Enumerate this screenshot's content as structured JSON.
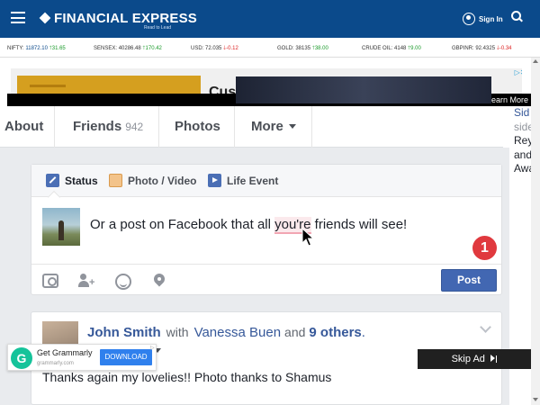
{
  "header": {
    "logo": "FINANCIAL EXPRESS",
    "tagline": "Read to Lead",
    "signin": "Sign In"
  },
  "ticker": [
    {
      "name": "NIFTY:",
      "value": "11872.10",
      "change": "31.65",
      "dir": "up"
    },
    {
      "name": "SENSEX:",
      "value": "40286.48",
      "change": "170.42",
      "dir": "up"
    },
    {
      "name": "USD:",
      "value": "72.035",
      "change": "-0.12",
      "dir": "down"
    },
    {
      "name": "GOLD:",
      "value": "38135",
      "change": "38.00",
      "dir": "up"
    },
    {
      "name": "CRUDE OIL:",
      "value": "4148",
      "change": "9.00",
      "dir": "up"
    },
    {
      "name": "GBPINR:",
      "value": "92.4325",
      "change": "-0.34",
      "dir": "down"
    }
  ],
  "ad": {
    "headline": "Custom Professional",
    "learn_more": "Learn More",
    "close": "▷✕"
  },
  "fb_nav": {
    "about": "About",
    "friends": "Friends",
    "friends_count": "942",
    "photos": "Photos",
    "more": "More"
  },
  "side_peek": [
    "Sid",
    "side",
    "Rey",
    "and",
    "Awa"
  ],
  "composer": {
    "tabs": [
      "Status",
      "Photo / Video",
      "Life Event"
    ],
    "text_before": "Or a post on Facebook that all ",
    "text_marked": "you're",
    "text_after": " friends will see!",
    "badge": "1",
    "post_button": "Post"
  },
  "post": {
    "author": "John Smith",
    "with": "with",
    "tagged": "Vanessa Buen",
    "and": "and",
    "others": "9 others",
    "period": ".",
    "text": "Thanks again my lovelies!! Photo thanks to Shamus"
  },
  "grammarly": {
    "title": "Get Grammarly",
    "url": "grammarly.com",
    "button": "DOWNLOAD",
    "info": "▷"
  },
  "skip_ad": "Skip Ad",
  "colors": {
    "header_blue": "#0b4a8b",
    "fb_blue": "#4267b2",
    "link_blue": "#365899",
    "badge_red": "#e0393e",
    "grammarly_green": "#15c39a"
  }
}
